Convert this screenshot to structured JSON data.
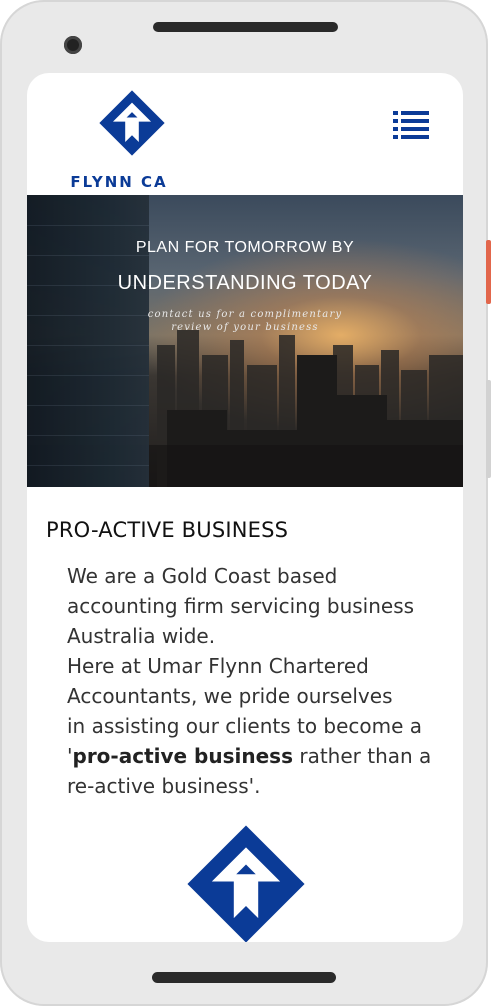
{
  "brand": {
    "name": "FLYNN CA",
    "color": "#0b3b97"
  },
  "header": {
    "menu_icon": "hamburger-list-icon"
  },
  "hero": {
    "title_line1": "PLAN FOR TOMORROW BY",
    "title_line2": "UNDERSTANDING TODAY",
    "subtitle_line1": "contact us for a complimentary",
    "subtitle_line2": "review of your business"
  },
  "section": {
    "title": "PRO-ACTIVE BUSINESS",
    "para1_line1": "We are a Gold Coast based",
    "para1_line2": "accounting firm servicing business",
    "para1_line3": "Australia wide.",
    "para2_line1": "Here at Umar Flynn Chartered",
    "para2_line2": "Accountants, we pride ourselves",
    "para2_line3": "in assisting our clients to become a",
    "para2_quote_open": "'",
    "para2_bold": "pro-active business",
    "para2_after_bold": " rather than a",
    "para2_line5": "re-active business'."
  }
}
